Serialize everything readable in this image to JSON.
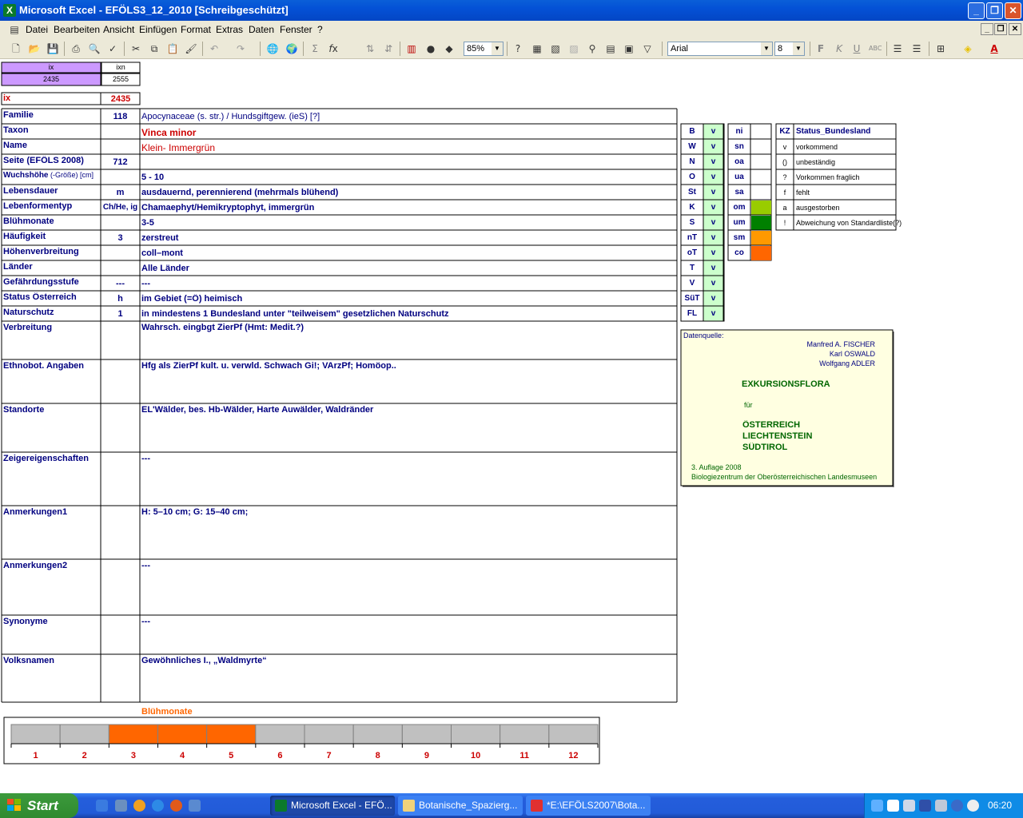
{
  "window": {
    "title": "Microsoft Excel - EFÖLS3_12_2010  [Schreibgeschützt]",
    "app_icon": "X"
  },
  "menu": [
    "Datei",
    "Bearbeiten",
    "Ansicht",
    "Einfügen",
    "Format",
    "Extras",
    "Daten",
    "Fenster",
    "?"
  ],
  "toolbar": {
    "zoom": "85%",
    "font": "Arial",
    "font_size": "8",
    "bold": "F",
    "italic": "K",
    "underline": "U"
  },
  "header": {
    "ix_label": "ix",
    "ixn_label": "ixn",
    "ix_value": "2435",
    "ixn_value": "2555",
    "ix2_label": "ix",
    "ix2_value": "2435"
  },
  "fields": [
    {
      "label": "Familie",
      "code": "118",
      "value": "Apocynaceae (s. str.)  /  Hundsgiftgew. (ieS) [?]"
    },
    {
      "label": "Taxon",
      "code": "",
      "value": "Vinca minor"
    },
    {
      "label": "Name",
      "code": "",
      "value": "Klein- Immergrün"
    },
    {
      "label": "Seite (EFÖLS 2008)",
      "code": "712",
      "value": ""
    },
    {
      "label": "Wuchshöhe",
      "label_suffix": "(-Größe) [cm]",
      "code": "",
      "value": " 5 - 10"
    },
    {
      "label": "Lebensdauer",
      "code": "m",
      "value": "ausdauernd, perennierend (mehrmals blühend)"
    },
    {
      "label": "Lebenformentyp",
      "code": "Ch/He, ig",
      "value": "Chamaephyt/Hemikryptophyt, immergrün"
    },
    {
      "label": "Blühmonate",
      "code": "",
      "value": " 3-5"
    },
    {
      "label": "Häufigkeit",
      "code": "3",
      "value": "zerstreut"
    },
    {
      "label": "Höhenverbreitung",
      "code": "",
      "value": "coll–mont"
    },
    {
      "label": "Länder",
      "code": "",
      "value": "Alle Länder"
    },
    {
      "label": "Gefährdungsstufe",
      "code": "---",
      "value": "  ---"
    },
    {
      "label": "Status Österreich",
      "code": "h",
      "value": "im Gebiet (=Ö) heimisch"
    },
    {
      "label": "Naturschutz",
      "code": "1",
      "value": "in mindestens 1 Bundesland unter \"teilweisem\" gesetzlichen Naturschutz"
    },
    {
      "label": "Verbreitung",
      "code": "",
      "value": "Wahrsch. eingbgt ZierPf (Hmt: Medit.?)"
    },
    {
      "label": "Ethnobot. Angaben",
      "code": "",
      "value": "Hfg als ZierPf kult. u. verwld. Schwach Gi!; VArzPf; Homöop.."
    },
    {
      "label": "Standorte",
      "code": "",
      "value": "EL'Wälder, bes. Hb-Wälder, Harte Auwälder, Waldränder"
    },
    {
      "label": "Zeigereigenschaften",
      "code": "",
      "value": "---"
    },
    {
      "label": "Anmerkungen1",
      "code": "",
      "value": "H: 5–10 cm; G: 15–40 cm;"
    },
    {
      "label": "Anmerkungen2",
      "code": "",
      "value": "---"
    },
    {
      "label": "Synonyme",
      "code": "",
      "value": "---"
    },
    {
      "label": "Volksnamen",
      "code": "",
      "value": "Gewöhnliches I., „Waldmyrte“"
    }
  ],
  "states": [
    {
      "code": "B",
      "v": "v"
    },
    {
      "code": "W",
      "v": "v"
    },
    {
      "code": "N",
      "v": "v"
    },
    {
      "code": "O",
      "v": "v"
    },
    {
      "code": "St",
      "v": "v"
    },
    {
      "code": "K",
      "v": "v"
    },
    {
      "code": "S",
      "v": "v"
    },
    {
      "code": "nT",
      "v": "v"
    },
    {
      "code": "oT",
      "v": "v"
    },
    {
      "code": "T",
      "v": "v"
    },
    {
      "code": "V",
      "v": "v"
    },
    {
      "code": "SüT",
      "v": "v"
    },
    {
      "code": "FL",
      "v": "v"
    }
  ],
  "altitude": [
    {
      "code": "ni",
      "color": ""
    },
    {
      "code": "sn",
      "color": ""
    },
    {
      "code": "oa",
      "color": ""
    },
    {
      "code": "ua",
      "color": ""
    },
    {
      "code": "sa",
      "color": ""
    },
    {
      "code": "om",
      "color": "#99cc00"
    },
    {
      "code": "um",
      "color": "#008000"
    },
    {
      "code": "sm",
      "color": "#ff9900"
    },
    {
      "code": "co",
      "color": "#ff6600"
    }
  ],
  "status_legend": {
    "kz_header": "KZ",
    "status_header": "Status_Bundesland",
    "rows": [
      {
        "code": "v",
        "text": "vorkommend"
      },
      {
        "code": "()",
        "text": "unbeständig"
      },
      {
        "code": "?",
        "text": "Vorkommen fraglich"
      },
      {
        "code": "f",
        "text": "fehlt"
      },
      {
        "code": "a",
        "text": "ausgestorben"
      },
      {
        "code": "!",
        "text": "Abweichung von Standardliste(?)"
      }
    ]
  },
  "source": {
    "label": "Datenquelle:",
    "authors": [
      "Manfred A. FISCHER",
      "Karl OSWALD",
      "Wolfgang ADLER"
    ],
    "title": "EXKURSIONSFLORA",
    "fuer": "für",
    "countries": [
      "ÖSTERREICH",
      "LIECHTENSTEIN",
      "SÜDTIROL"
    ],
    "edition": "3. Auflage 2008",
    "publisher": "Biologiezentrum der Oberösterreichischen Landesmuseen"
  },
  "chart_data": {
    "type": "bar",
    "title": "Blühmonate",
    "categories": [
      "1",
      "2",
      "3",
      "4",
      "5",
      "6",
      "7",
      "8",
      "9",
      "10",
      "11",
      "12"
    ],
    "values": [
      0,
      0,
      1,
      1,
      1,
      0,
      0,
      0,
      0,
      0,
      0,
      0
    ],
    "colors": {
      "active": "#ff6600",
      "inactive": "#c0c0c0"
    }
  },
  "taskbar": {
    "start": "Start",
    "tasks": [
      {
        "label": "Microsoft Excel - EFÖ...",
        "active": true
      },
      {
        "label": "Botanische_Spazierg...",
        "active": false
      },
      {
        "label": "*E:\\EFÖLS2007\\Bota...",
        "active": false
      }
    ],
    "clock": "06:20"
  }
}
